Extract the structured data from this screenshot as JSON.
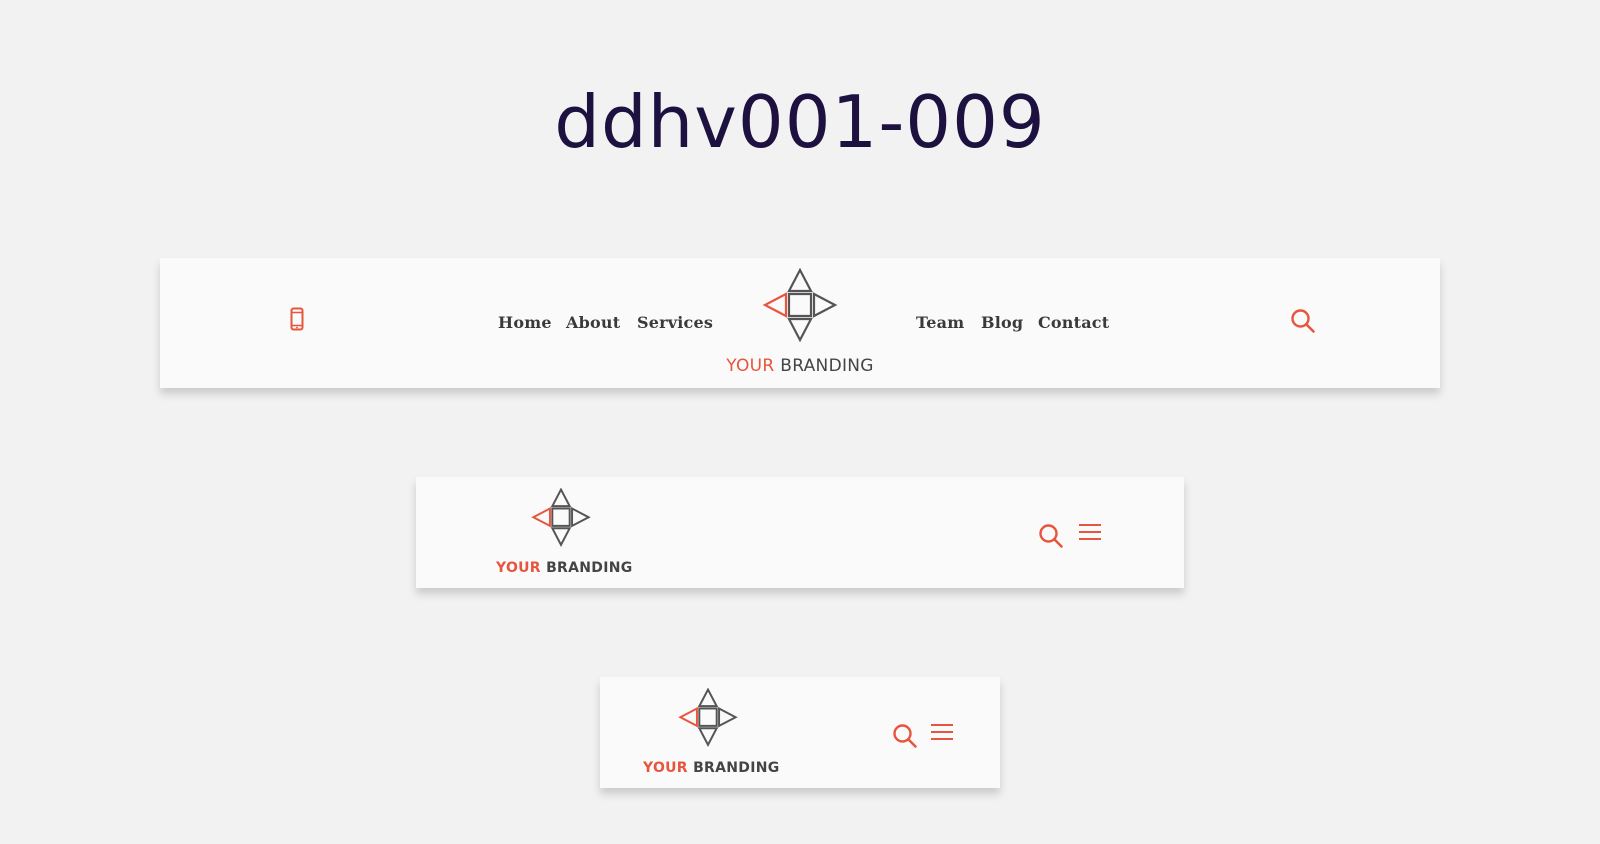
{
  "page": {
    "title": "ddhv001-009"
  },
  "colors": {
    "background": "#f2f2f2",
    "title": "#1d1140",
    "header_background": "#fafafa",
    "accent": "#e8553e",
    "logo_stroke": "#555555",
    "nav_text": "#3a3a3a"
  },
  "brand": {
    "word_accent": "YOUR",
    "word_main": "BRANDING"
  },
  "headers": {
    "desktop": {
      "phone_icon": "phone-icon",
      "nav_left": [
        "Home",
        "About",
        "Services"
      ],
      "nav_right": [
        "Team",
        "Blog",
        "Contact"
      ],
      "search_icon": "search-icon"
    },
    "tablet": {
      "search_icon": "search-icon",
      "menu_icon": "hamburger-menu-icon"
    },
    "mobile": {
      "search_icon": "search-icon",
      "menu_icon": "hamburger-menu-icon"
    }
  }
}
